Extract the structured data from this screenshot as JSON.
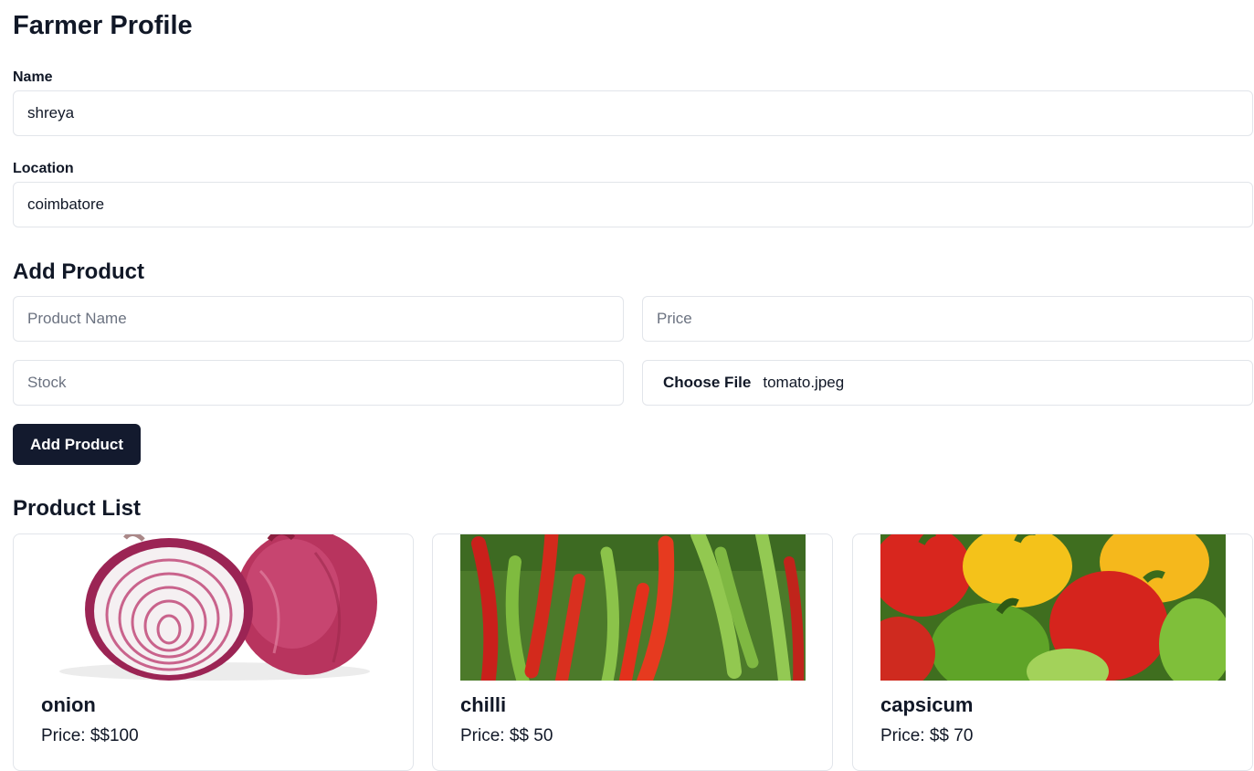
{
  "profile": {
    "title": "Farmer Profile",
    "name_label": "Name",
    "name_value": "shreya",
    "location_label": "Location",
    "location_value": "coimbatore"
  },
  "add_product": {
    "title": "Add Product",
    "product_name_placeholder": "Product Name",
    "price_placeholder": "Price",
    "stock_placeholder": "Stock",
    "choose_file_label": "Choose File",
    "file_name": "tomato.jpeg",
    "button_label": "Add Product"
  },
  "product_list": {
    "title": "Product List",
    "items": [
      {
        "name": "onion",
        "price": "Price: $$100",
        "image": "onion-image"
      },
      {
        "name": "chilli",
        "price": "Price: $$ 50",
        "image": "chilli-image"
      },
      {
        "name": "capsicum",
        "price": "Price: $$ 70",
        "image": "capsicum-image"
      }
    ]
  },
  "colors": {
    "primary_button": "#131a2e",
    "border": "#e2e5ea",
    "text": "#111827"
  }
}
